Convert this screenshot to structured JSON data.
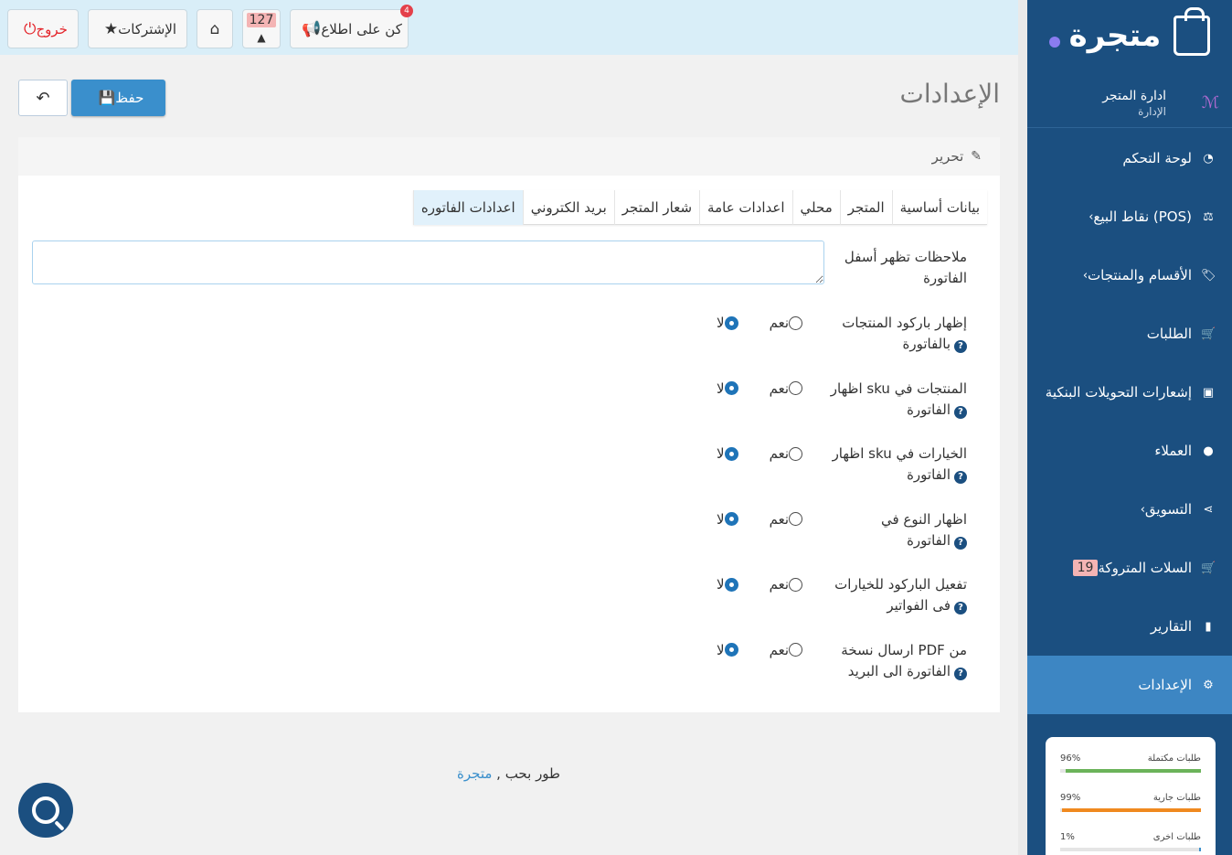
{
  "topbar": {
    "logout_label": "خروج",
    "subscriptions_label": "الإشتركات",
    "bell_count": "127",
    "announce_label": "كن على اطلاع",
    "announce_badge": "4"
  },
  "sidebar": {
    "logo_text": "متجرة",
    "user_name": "ادارة المتجر",
    "user_role": "الإدارة",
    "items": [
      {
        "label": "لوحة التحكم",
        "icon": "dashboard-icon"
      },
      {
        "label": "نقاط البيع (POS)",
        "icon": "scale-icon",
        "chevron": true
      },
      {
        "label": "الأقسام والمنتجات",
        "icon": "tag-icon",
        "chevron": true
      },
      {
        "label": "الطلبات",
        "icon": "cart-icon"
      },
      {
        "label": "إشعارات التحويلات البنكية",
        "icon": "money-icon"
      },
      {
        "label": "العملاء",
        "icon": "user-icon"
      },
      {
        "label": "التسويق",
        "icon": "share-icon",
        "chevron": true
      },
      {
        "label": "السلات المتروكة",
        "icon": "cart-icon",
        "badge": "19"
      },
      {
        "label": "التقارير",
        "icon": "chart-icon"
      },
      {
        "label": "الإعدادات",
        "icon": "gear-icon",
        "active": true
      }
    ],
    "stats": [
      {
        "label": "طلبات مكتملة",
        "value": "96%",
        "fraction": 0.96,
        "color": "#6bb35a"
      },
      {
        "label": "طلبات جارية",
        "value": "99%",
        "fraction": 0.99,
        "color": "#f0891f"
      },
      {
        "label": "طلبات اخرى",
        "value": "1%",
        "fraction": 0.01,
        "color": "#3a8fcc"
      }
    ]
  },
  "page": {
    "title": "الإعدادات",
    "save_label": "حفظ",
    "edit_label": "تحرير"
  },
  "tabs": [
    "بيانات أساسية",
    "المتجر",
    "محلي",
    "اعدادات عامة",
    "شعار المتجر",
    "بريد الكتروني",
    "اعدادات الفاتوره"
  ],
  "form": {
    "notes_label": "ملاحظات تظهر أسفل الفاتورة",
    "notes_value": "",
    "yes_label": "نعم",
    "no_label": "لا",
    "fields": [
      {
        "line1": "إظهار باركود المنتجات",
        "line2": "بالفاتورة",
        "value": "no"
      },
      {
        "line1": "اظهار sku المنتجات في",
        "line2": "الفاتورة",
        "value": "no"
      },
      {
        "line1": "اظهار sku الخيارات في",
        "line2": "الفاتورة",
        "value": "no"
      },
      {
        "line1": "اظهار النوع في",
        "line2": "الفاتورة",
        "value": "no"
      },
      {
        "line1": "تفعيل الباركود للخيارات",
        "line2": "فى الفواتير",
        "value": "no"
      },
      {
        "line1": "ارسال نسخة PDF من",
        "line2": "الفاتورة الى البريد",
        "value": "no"
      }
    ]
  },
  "footer": {
    "text": "طور بحب ,",
    "link": "متجرة"
  }
}
